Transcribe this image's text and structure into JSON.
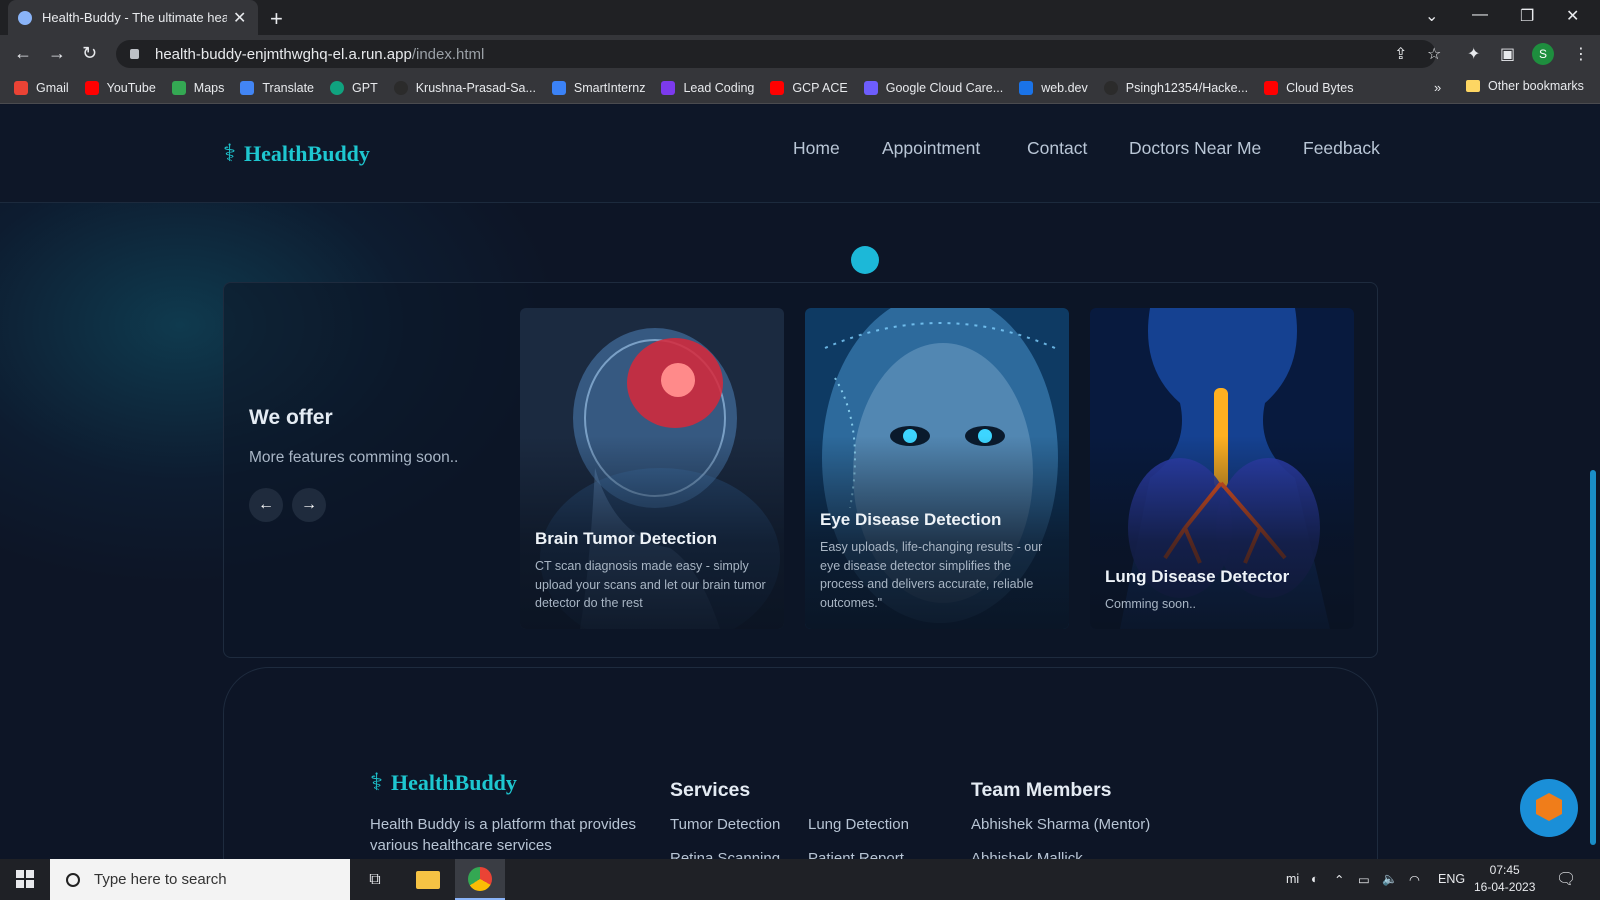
{
  "browser": {
    "tab_title": "Health-Buddy - The ultimate hea",
    "url_host": "health-buddy-enjmthwghq-el.a.run.app",
    "url_path": "/index.html",
    "profile_initial": "S",
    "bookmarks": [
      "Gmail",
      "YouTube",
      "Maps",
      "Translate",
      "GPT",
      "Krushna-Prasad-Sa...",
      "SmartInternz",
      "Lead Coding",
      "GCP ACE",
      "Google Cloud Care...",
      "web.dev",
      "Psingh12354/Hacke...",
      "Cloud Bytes"
    ],
    "more_bookmarks": "»",
    "other_bookmarks": "Other bookmarks"
  },
  "site": {
    "brand": "HealthBuddy",
    "nav": [
      "Home",
      "Appointment",
      "Contact",
      "Doctors Near Me",
      "Feedback"
    ]
  },
  "offer": {
    "title": "We offer",
    "subtitle": "More features comming soon..",
    "prev_icon": "←",
    "next_icon": "→",
    "cards": [
      {
        "title": "Brain Tumor Detection",
        "desc": "CT scan diagnosis made easy - simply upload your scans and let our brain tumor detector do the rest"
      },
      {
        "title": "Eye Disease Detection",
        "desc": "Easy uploads, life-changing results - our eye disease detector simplifies the process and delivers accurate, reliable outcomes.\""
      },
      {
        "title": "Lung Disease Detector",
        "desc": "Comming soon.."
      }
    ]
  },
  "footer": {
    "brand": "HealthBuddy",
    "description": "Health Buddy is a platform that provides various healthcare services",
    "services_heading": "Services",
    "services": [
      "Tumor Detection",
      "Lung Detection",
      "Retina Scanning",
      "Patient Report"
    ],
    "team_heading": "Team Members",
    "team": [
      "Abhishek Sharma (Mentor)",
      "Abhishek Mallick"
    ]
  },
  "taskbar": {
    "search_placeholder": "Type here to search",
    "language": "ENG",
    "time": "07:45",
    "date": "16-04-2023"
  },
  "colors": {
    "brand": "#1ec7d0",
    "page_bg": "#0d1526",
    "accent_dot": "#1cb8d8"
  }
}
